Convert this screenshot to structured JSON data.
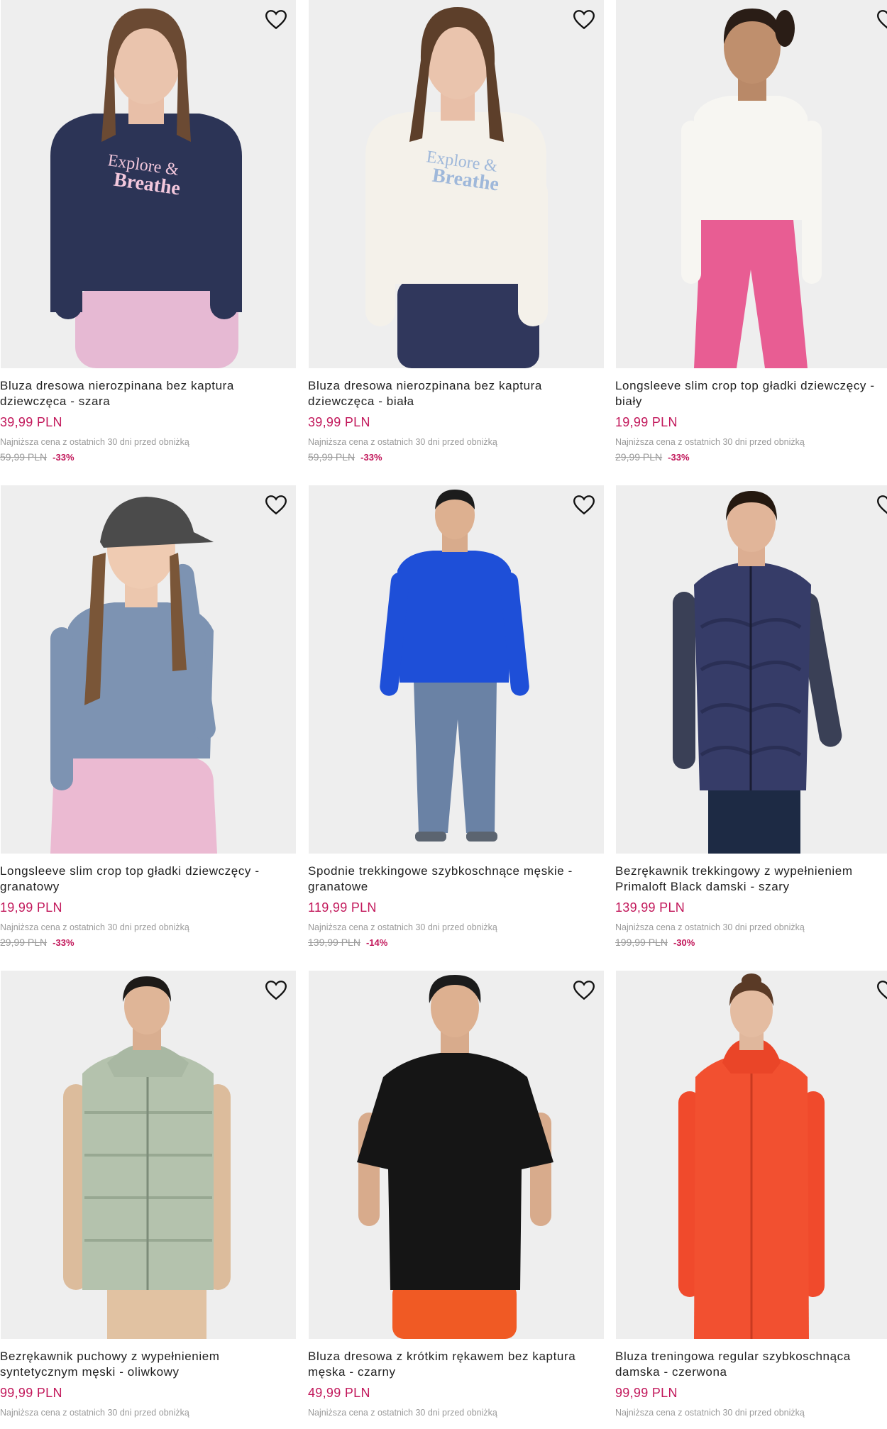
{
  "products": [
    {
      "name_line1": "Bluza dresowa nierozpinana bez kaptura",
      "name_line2": "dziewczęca - szara",
      "price": "39,99 PLN",
      "lowest_label": "Najniższa cena z ostatnich 30 dni przed obniżką",
      "old_price": "59,99 PLN",
      "discount": "-33%",
      "image_icon": "girl-navy-sweatshirt-photo"
    },
    {
      "name_line1": "Bluza dresowa nierozpinana bez kaptura",
      "name_line2": "dziewczęca - biała",
      "price": "39,99 PLN",
      "lowest_label": "Najniższa cena z ostatnich 30 dni przed obniżką",
      "old_price": "59,99 PLN",
      "discount": "-33%",
      "image_icon": "girl-white-sweatshirt-photo"
    },
    {
      "name_line1": "Longsleeve slim crop top gładki dziewczęcy -",
      "name_line2": "biały",
      "price": "19,99 PLN",
      "lowest_label": "Najniższa cena z ostatnich 30 dni przed obniżką",
      "old_price": "29,99 PLN",
      "discount": "-33%",
      "image_icon": "girl-white-longsleeve-photo"
    },
    {
      "name_line1": "Longsleeve slim crop top gładki dziewczęcy -",
      "name_line2": "granatowy",
      "price": "19,99 PLN",
      "lowest_label": "Najniższa cena z ostatnich 30 dni przed obniżką",
      "old_price": "29,99 PLN",
      "discount": "-33%",
      "image_icon": "girl-blue-longsleeve-photo"
    },
    {
      "name_line1": "Spodnie trekkingowe szybkoschnące męskie -",
      "name_line2": "granatowe",
      "price": "119,99 PLN",
      "lowest_label": "Najniższa cena z ostatnich 30 dni przed obniżką",
      "old_price": "139,99 PLN",
      "discount": "-14%",
      "image_icon": "man-trekking-trousers-photo"
    },
    {
      "name_line1": "Bezrękawnik trekkingowy z wypełnieniem",
      "name_line2": "Primaloft Black damski - szary",
      "price": "139,99 PLN",
      "lowest_label": "Najniższa cena z ostatnich 30 dni przed obniżką",
      "old_price": "199,99 PLN",
      "discount": "-30%",
      "image_icon": "woman-quilted-vest-photo"
    },
    {
      "name_line1": "Bezrękawnik puchowy z wypełnieniem",
      "name_line2": "syntetycznym męski - oliwkowy",
      "price": "99,99 PLN",
      "lowest_label": "Najniższa cena z ostatnich 30 dni przed obniżką",
      "old_price": "",
      "discount": "",
      "image_icon": "man-olive-puffer-vest-photo"
    },
    {
      "name_line1": "Bluza dresowa z krótkim rękawem bez kaptura",
      "name_line2": "męska - czarny",
      "price": "49,99 PLN",
      "lowest_label": "Najniższa cena z ostatnich 30 dni przed obniżką",
      "old_price": "",
      "discount": "",
      "image_icon": "man-black-tshirt-photo"
    },
    {
      "name_line1": "Bluza treningowa regular szybkoschnąca",
      "name_line2": "damska - czerwona",
      "price": "99,99 PLN",
      "lowest_label": "Najniższa cena z ostatnich 30 dni przed obniżką",
      "old_price": "",
      "discount": "",
      "image_icon": "woman-red-training-jacket-photo"
    }
  ],
  "wishlist_icon": "heart-outline-icon",
  "colors": {
    "price": "#c2185b",
    "muted": "#9a9a9a",
    "image_bg": "#f0f0f0"
  }
}
